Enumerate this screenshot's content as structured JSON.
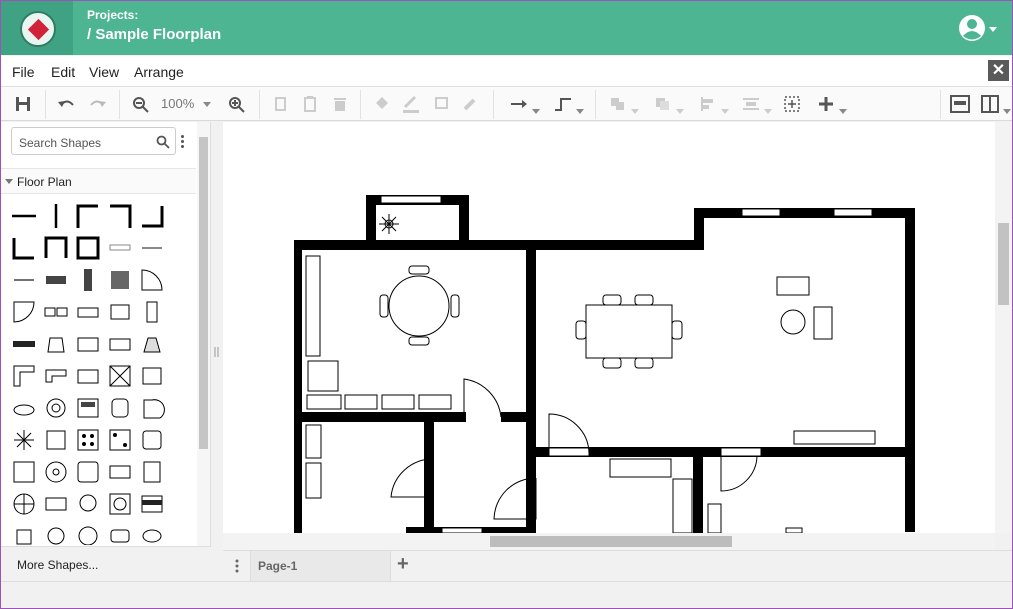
{
  "header": {
    "projects_label": "Projects:",
    "title": "/ Sample Floorplan"
  },
  "menu": [
    "File",
    "Edit",
    "View",
    "Arrange"
  ],
  "toolbar": {
    "zoom": "100%"
  },
  "sidebar": {
    "search_placeholder": "Search Shapes",
    "section_label": "Floor Plan",
    "more_shapes": "More Shapes..."
  },
  "tabs": {
    "page_label": "Page-1",
    "add_page": "+"
  },
  "colors": {
    "header": "#4db592",
    "logo_bg": "#3fa282",
    "brand_red": "#d0233a"
  }
}
